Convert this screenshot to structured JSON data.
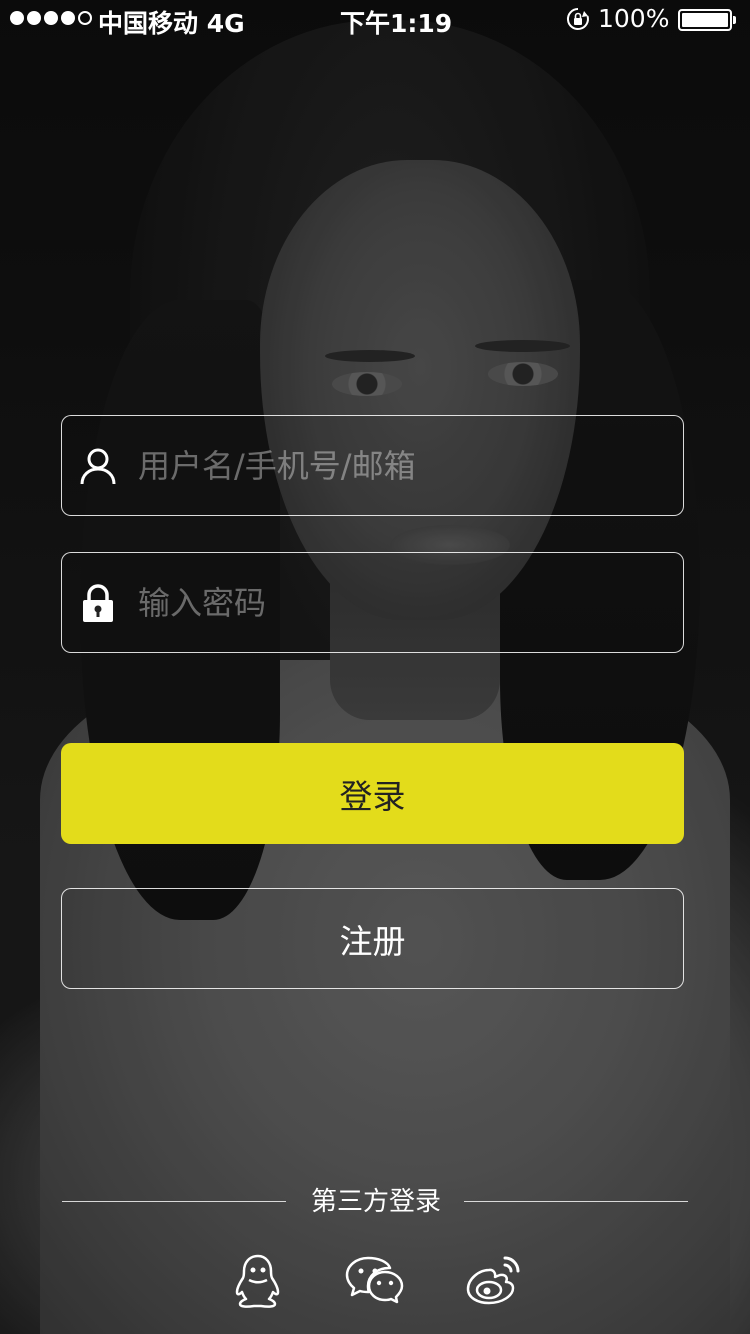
{
  "status_bar": {
    "carrier": "中国移动 4G",
    "time": "下午1:19",
    "battery": "100%",
    "signal_bars_filled": 4,
    "signal_bars_total": 5
  },
  "login_form": {
    "username_placeholder": "用户名/手机号/邮箱",
    "password_placeholder": "输入密码",
    "login_label": "登录",
    "register_label": "注册"
  },
  "third_party": {
    "label": "第三方登录",
    "providers": [
      "qq-icon",
      "wechat-icon",
      "weibo-icon"
    ]
  },
  "colors": {
    "accent": "#e3dc1b"
  }
}
